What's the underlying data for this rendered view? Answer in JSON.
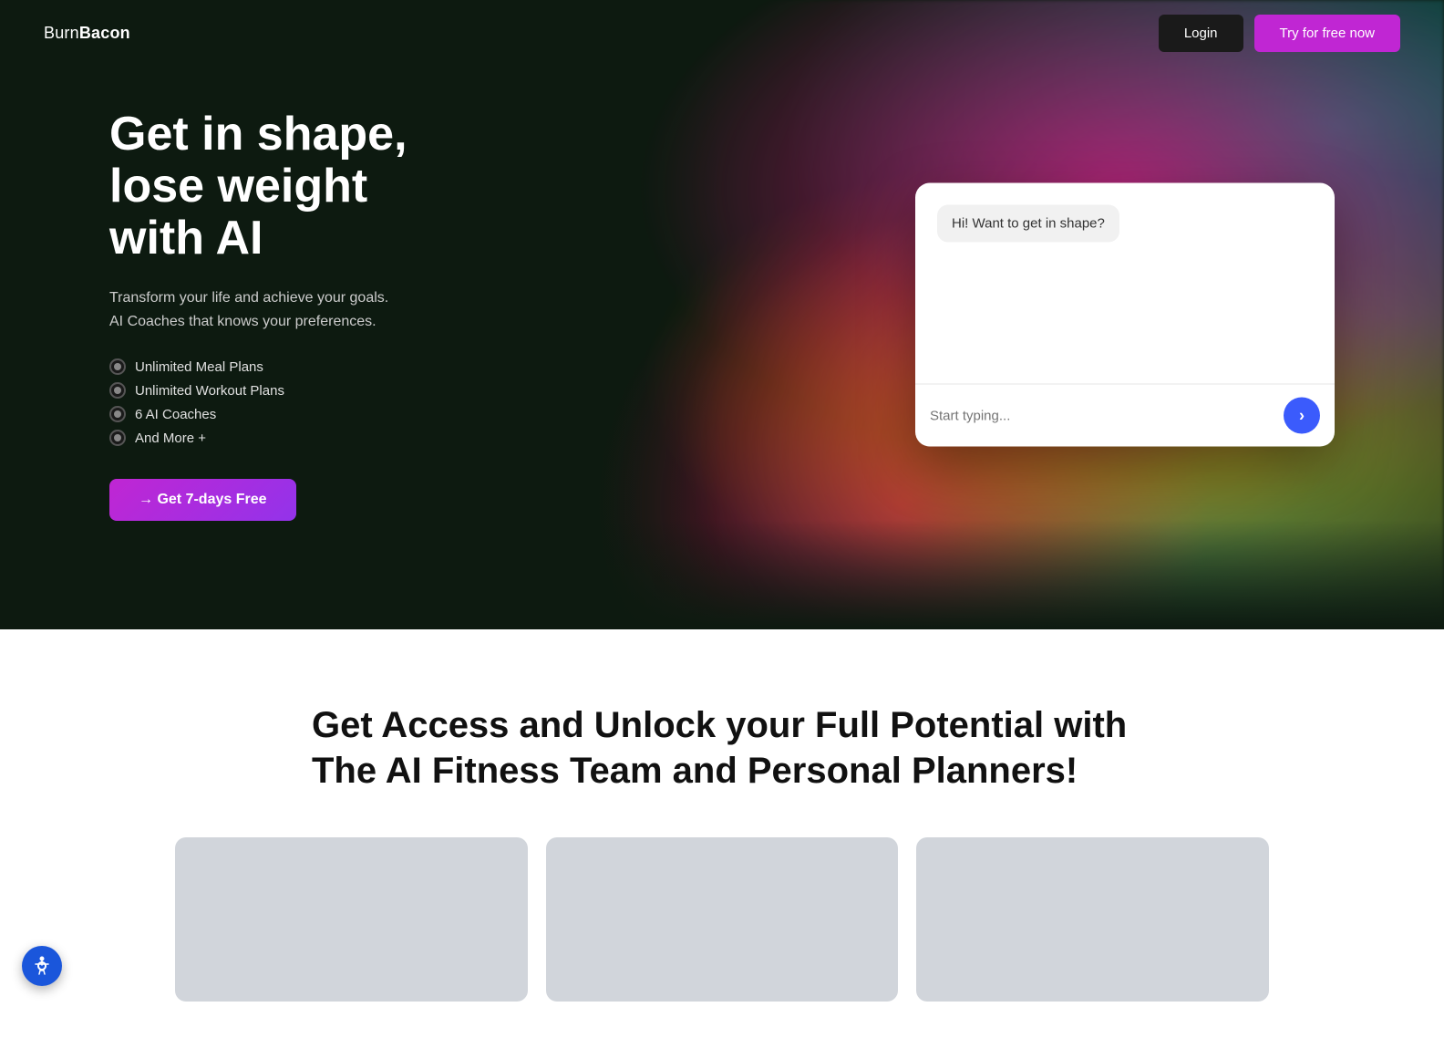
{
  "brand": {
    "name_plain": "Burn",
    "name_bold": "Bacon"
  },
  "navbar": {
    "login_label": "Login",
    "try_label": "Try for free now"
  },
  "hero": {
    "title": "Get in shape, lose weight with AI",
    "subtitle_line1": "Transform your life and achieve your goals.",
    "subtitle_line2": "AI Coaches that knows your preferences.",
    "features": [
      "Unlimited Meal Plans",
      "Unlimited Workout Plans",
      "6 AI Coaches",
      "And More +"
    ],
    "cta_label": "→ Get 7-days Free"
  },
  "chat": {
    "greeting": "Hi! Want to get in shape?",
    "input_placeholder": "Start typing..."
  },
  "section": {
    "title": "Get Access and Unlock your Full Potential with The AI Fitness Team and Personal Planners!"
  },
  "icons": {
    "send": "›",
    "arrow": "→"
  }
}
